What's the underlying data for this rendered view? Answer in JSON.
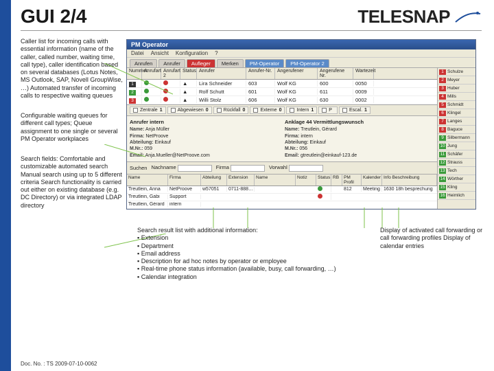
{
  "slide": {
    "title": "GUI 2/4",
    "brand": "TELESNAP",
    "doc_no": "Doc. No. : TS 2009-07-10-0062"
  },
  "left": {
    "b1": "Caller list for incoming calls with essential information (name of the caller, called number, waiting time, call type), caller identification based on several databases (Lotus Notes, MS Outlook, SAP, Novell GroupWise, …)\nAutomated transfer of incoming calls to respective waiting queues",
    "b2": "Configurable waiting queues for different call types;\nQueue assignment to one single or several PM Operator workplaces",
    "b3": "Search fields:\nComfortable and customizable automated search\nManual search using up to 5 different criteria\nSearch functionality is carried out either on existing database (e.g. DC Directory) or via integrated LDAP directory"
  },
  "bottom": {
    "c1_head": "Search result list with additional information:",
    "c1_items": [
      "Extension",
      "Department",
      "Email address",
      "Description for ad hoc notes by operator or employee",
      "Real-time phone status information (available, busy, call forwarding, …)",
      "Calendar integration"
    ],
    "c2": "Display of activated call forwarding or call forwarding profiles\nDisplay of calendar entries"
  },
  "pm": {
    "title": "PM Operator",
    "menus": [
      "Datei",
      "Ansicht",
      "Konfiguration",
      "?"
    ],
    "tabs": [
      "Anrufen",
      "Anrufer",
      "Aufleger",
      "Merken",
      "PM-Operator",
      "PM-Operator 2"
    ],
    "cols": [
      "Nummer",
      "Anrufart",
      "Anrufart 2",
      "Status",
      "Anrufer",
      "Anrufer-Nr.",
      "Angerufener",
      "Angerufene Nr.",
      "Wartezeit"
    ],
    "rows": [
      {
        "n": "1",
        "nb": "nb1",
        "name": "Lira Schneider",
        "nr": "603",
        "f": "Wolf KG",
        "gn": "600",
        "wz": "0050"
      },
      {
        "n": "2",
        "nb": "nb2",
        "name": "Rolf Schutt",
        "nr": "601",
        "f": "Wolf KG",
        "gn": "611",
        "wz": "0009"
      },
      {
        "n": "3",
        "nb": "nb3",
        "name": "Willi Stolz",
        "nr": "606",
        "f": "Wolf KG",
        "gn": "630",
        "wz": "0002"
      }
    ],
    "queues": [
      {
        "l": "Zentrale",
        "v": "1"
      },
      {
        "l": "Abgewiesen",
        "v": "0"
      },
      {
        "l": "Rückfall",
        "v": "0"
      },
      {
        "l": "Externe",
        "v": "0"
      },
      {
        "l": "Intern",
        "v": "1"
      },
      {
        "l": "P",
        "v": ""
      },
      {
        "l": "Escal.",
        "v": "1"
      }
    ],
    "detail_left_h": "Anrufer intern",
    "detail_right_h": "Anklage 44 Vermittlungswunsch",
    "detail_left": [
      [
        "Name:",
        "Anja Müller"
      ],
      [
        "Firma:",
        "NetProove"
      ],
      [
        "Abteilung:",
        "Einkauf"
      ],
      [
        "M.Nr.:",
        "059"
      ],
      [
        "Email:",
        "Anja.Mueller@NetProove.com"
      ]
    ],
    "detail_right": [
      [
        "Name:",
        "Treutlein, Gérard"
      ],
      [
        "Firma:",
        "intern"
      ],
      [
        "Abteilung:",
        "Einkauf"
      ],
      [
        "M.Nr.:",
        "056"
      ],
      [
        "Email:",
        "gtreutlein@einkauf-123.de"
      ]
    ],
    "search_labels": [
      "Suchen",
      "Nachname",
      "Firma",
      "Vorwahl"
    ],
    "res_cols": [
      "Name",
      "Firma",
      "Abteilung",
      "Extension",
      "Name",
      "Notiz",
      "Status",
      "RB",
      "PM Profil",
      "Kalender",
      "Info Beschreibung"
    ],
    "res_rows": [
      {
        "nm": "Treutlein, Anna",
        "f": "NetProove",
        "ab": "w57051",
        "ext": "0711-888…",
        "nm2": "",
        "nt": "",
        "st": "g",
        "pp": "812",
        "kal": "Meeting",
        "info": "1630 18h besprechung"
      },
      {
        "nm": "Treutlein, Gabi",
        "f": "Support",
        "ab": "",
        "ext": "",
        "nm2": "",
        "nt": "",
        "st": "r",
        "pp": "",
        "kal": "",
        "info": ""
      },
      {
        "nm": "Treutlein, Gérard",
        "f": "intern",
        "ab": "",
        "ext": "",
        "nm2": "",
        "nt": "",
        "st": "",
        "pp": "",
        "kal": "",
        "info": ""
      }
    ],
    "sidebar": [
      {
        "c": "r",
        "l": "Schulze"
      },
      {
        "c": "r",
        "l": "Meyer"
      },
      {
        "c": "r",
        "l": "Huber"
      },
      {
        "c": "r",
        "l": "Mills"
      },
      {
        "c": "r",
        "l": "Schmidt"
      },
      {
        "c": "r",
        "l": "Klingel"
      },
      {
        "c": "r",
        "l": "Langes"
      },
      {
        "c": "r",
        "l": "Baguce"
      },
      {
        "c": "g",
        "l": "Silbermann"
      },
      {
        "c": "g",
        "l": "Jung"
      },
      {
        "c": "g",
        "l": "Schäfer"
      },
      {
        "c": "g",
        "l": "Strauss"
      },
      {
        "c": "g",
        "l": "Tech"
      },
      {
        "c": "g",
        "l": "Wörther"
      },
      {
        "c": "g",
        "l": "Kling"
      },
      {
        "c": "g",
        "l": "Heimlich"
      }
    ]
  }
}
